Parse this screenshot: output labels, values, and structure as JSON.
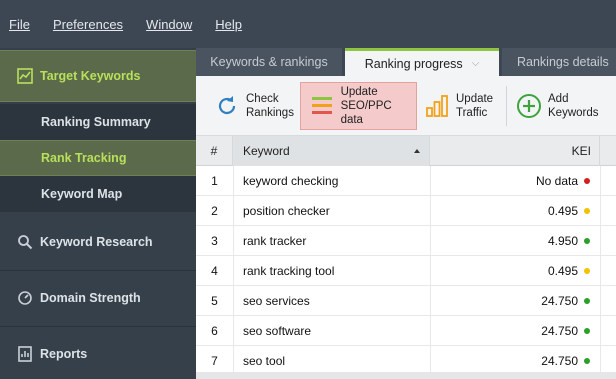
{
  "menu": [
    {
      "label": "File"
    },
    {
      "label": "Preferences"
    },
    {
      "label": "Window"
    },
    {
      "label": "Help"
    }
  ],
  "sidebar": {
    "target_keywords": "Target Keywords",
    "sub_items": [
      {
        "label": "Ranking Summary",
        "active": false
      },
      {
        "label": "Rank Tracking",
        "active": true
      },
      {
        "label": "Keyword Map",
        "active": false
      }
    ],
    "keyword_research": "Keyword Research",
    "domain_strength": "Domain Strength",
    "reports": "Reports"
  },
  "tabs": [
    {
      "label": "Keywords & rankings",
      "active": false
    },
    {
      "label": "Ranking progress",
      "active": true
    },
    {
      "label": "Rankings details",
      "active": false
    }
  ],
  "toolbar": {
    "check_line1": "Check",
    "check_line2": "Rankings",
    "update_seo_line1": "Update",
    "update_seo_line2": "SEO/PPC data",
    "update_traffic_line1": "Update",
    "update_traffic_line2": "Traffic",
    "add_line1": "Add",
    "add_line2": "Keywords"
  },
  "table": {
    "headers": {
      "num": "#",
      "keyword": "Keyword",
      "kei": "KEI"
    },
    "rows": [
      {
        "num": "1",
        "keyword": "keyword checking",
        "kei": "No data",
        "status": "#d21f1f"
      },
      {
        "num": "2",
        "keyword": "position checker",
        "kei": "0.495",
        "status": "#f2c200"
      },
      {
        "num": "3",
        "keyword": "rank tracker",
        "kei": "4.950",
        "status": "#2aa02a"
      },
      {
        "num": "4",
        "keyword": "rank tracking tool",
        "kei": "0.495",
        "status": "#f2c200"
      },
      {
        "num": "5",
        "keyword": "seo services",
        "kei": "24.750",
        "status": "#2aa02a"
      },
      {
        "num": "6",
        "keyword": "seo software",
        "kei": "24.750",
        "status": "#2aa02a"
      },
      {
        "num": "7",
        "keyword": "seo tool",
        "kei": "24.750",
        "status": "#2aa02a"
      }
    ]
  },
  "colors": {
    "accent_green": "#8cc63f",
    "active_text": "#b8e05a",
    "highlight_button": "#f4caca"
  }
}
